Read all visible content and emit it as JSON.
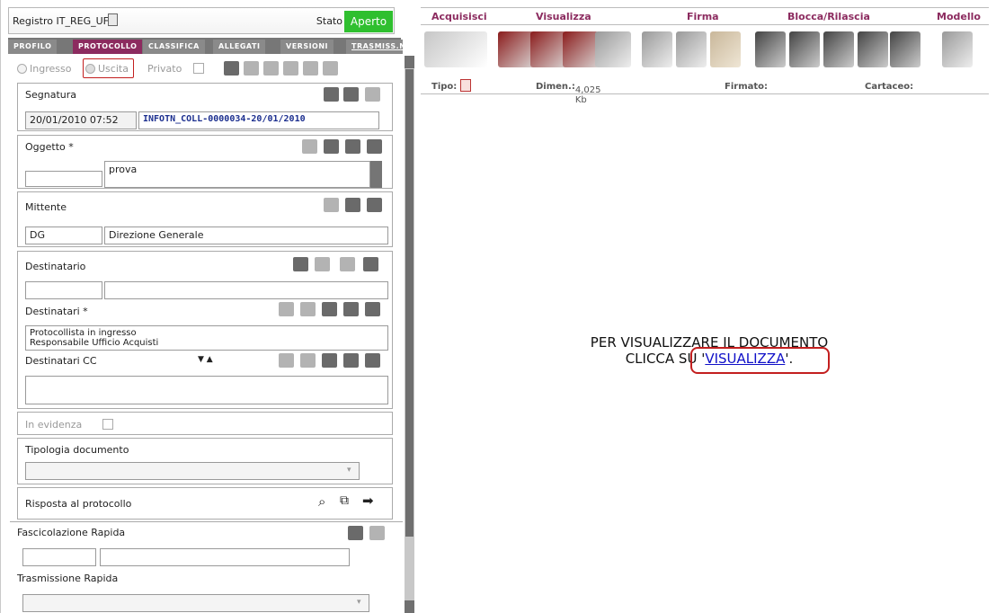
{
  "header": {
    "registro_label": "Registro",
    "registro_value": "IT_REG_UFF",
    "stato_label": "Stato",
    "stato_value": "Aperto"
  },
  "tabs": [
    {
      "label": "PROFILO"
    },
    {
      "label": "PROTOCOLLO"
    },
    {
      "label": "CLASSIFICA"
    },
    {
      "label": "ALLEGATI"
    },
    {
      "label": "VERSIONI"
    },
    {
      "label": "TRASMISS.NI"
    }
  ],
  "options": {
    "ingresso": "Ingresso",
    "uscita": "Uscita",
    "privato": "Privato"
  },
  "segnatura": {
    "title": "Segnatura",
    "date": "20/01/2010 07:52",
    "code": "INFOTN_COLL-0000034-20/01/2010"
  },
  "oggetto": {
    "title": "Oggetto *",
    "code": "",
    "text": "prova"
  },
  "mittente": {
    "title": "Mittente",
    "code": "DG",
    "name": "Direzione Generale"
  },
  "destinatario": {
    "title": "Destinatario",
    "code": "",
    "name": ""
  },
  "destinatari": {
    "title": "Destinatari *",
    "items": [
      "Protocollista in ingresso",
      "Responsabile Ufficio Acquisti"
    ]
  },
  "destinatari_cc": {
    "title": "Destinatari CC"
  },
  "evidenza": {
    "label": "In evidenza"
  },
  "tipologia": {
    "title": "Tipologia documento",
    "value": ""
  },
  "risposta": {
    "title": "Risposta al protocollo"
  },
  "fascicolazione": {
    "title": "Fascicolazione Rapida"
  },
  "trasmissione": {
    "title": "Trasmissione Rapida"
  },
  "toolbar": {
    "acquisisci": "Acquisisci",
    "visualizza": "Visualizza",
    "firma": "Firma",
    "blocca": "Blocca/Rilascia",
    "modello": "Modello"
  },
  "info": {
    "tipo": "Tipo:",
    "dimen_label": "Dimen.:",
    "dimen_value": "4,025 Kb",
    "firmato": "Firmato:",
    "cartaceo": "Cartaceo:"
  },
  "message": {
    "line1": "PER VISUALIZZARE IL DOCUMENTO",
    "line2_pre": "CLICCA SU '",
    "link": "VISUALIZZA",
    "line2_post": "'."
  },
  "colors": {
    "accent": "#8c2b5f",
    "aperto": "#2fbf2f",
    "highlight": "#c31f1f"
  }
}
